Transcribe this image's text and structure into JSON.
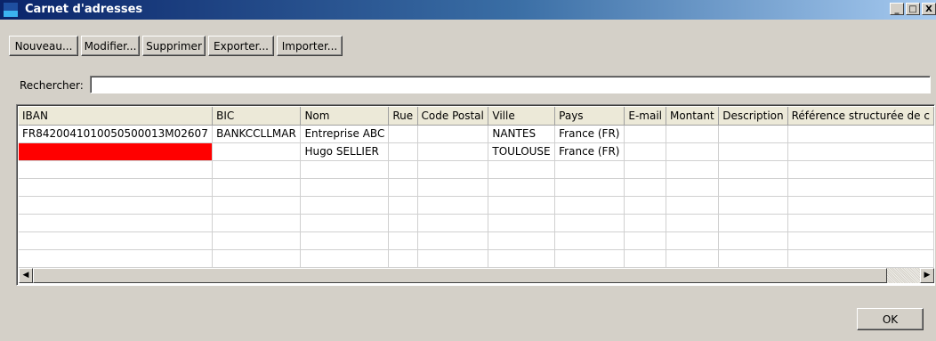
{
  "window": {
    "title": "Carnet d'adresses",
    "controls": {
      "minimize": "_",
      "maximize": "□",
      "close": "X"
    }
  },
  "toolbar": {
    "new_label": "Nouveau...",
    "edit_label": "Modifier...",
    "delete_label": "Supprimer",
    "export_label": "Exporter...",
    "import_label": "Importer..."
  },
  "search": {
    "label": "Rechercher:",
    "value": ""
  },
  "table": {
    "columns": [
      "IBAN",
      "BIC",
      "Nom",
      "Rue",
      "Code Postal",
      "Ville",
      "Pays",
      "E-mail",
      "Montant",
      "Description",
      "Référence structurée de c"
    ],
    "rows": [
      [
        "FR8420041010050500013M02607",
        "BANKCCLLMAR",
        "Entreprise ABC",
        "",
        "",
        "NANTES",
        "France (FR)",
        "",
        "",
        "",
        ""
      ],
      [
        "",
        "",
        "Hugo SELLIER",
        "",
        "",
        "TOULOUSE",
        "France (FR)",
        "",
        "",
        "",
        ""
      ]
    ],
    "highlight_color": "#ff0000"
  },
  "scrollbar": {
    "left_arrow": "◀",
    "right_arrow": "▶"
  },
  "footer": {
    "ok_label": "OK"
  }
}
